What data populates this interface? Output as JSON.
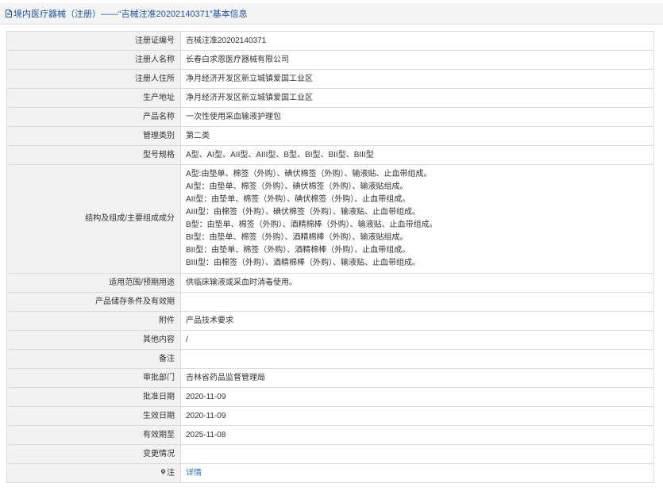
{
  "header": {
    "title": "境内医疗器械（注册）——“吉械注准20202140371”基本信息",
    "icon": "document-icon"
  },
  "rows": {
    "reg_no": {
      "label": "注册证编号",
      "value": "吉械注准20202140371"
    },
    "registrant": {
      "label": "注册人名称",
      "value": "长春白求恩医疗器械有限公司"
    },
    "registrant_address": {
      "label": "注册人住所",
      "value": "净月经济开发区新立城镇爱国工业区"
    },
    "production_address": {
      "label": "生产地址",
      "value": "净月经济开发区新立城镇爱国工业区"
    },
    "product_name": {
      "label": "产品名称",
      "value": "一次性使用采血输液护理包"
    },
    "category": {
      "label": "管理类别",
      "value": "第二类"
    },
    "models": {
      "label": "型号规格",
      "value": "A型、AI型、AII型、AIII型、B型、BI型、BII型、BIII型"
    },
    "composition": {
      "label": "结构及组成/主要组成成分",
      "lines": [
        "A型:由垫单、棉签（外购）、碘伏棉签（外购）、输液贴、止血带组成。",
        "AI型：由垫单、棉签（外购）、碘伏棉签（外购）、输液贴组成。",
        "AII型：由垫单、棉签（外购）、碘伏棉签（外购）、止血带组成。",
        "AIII型：由棉签（外购）、碘伏棉签（外购）、输液贴、止血带组成。",
        "B型：由垫单、棉签（外购）、酒精棉棒（外购）、输液贴、止血带组成。",
        "BI型：由垫单、棉签（外购）、酒精棉棒（外购）、输液贴组成。",
        "BII型：由垫单、棉签（外购）、酒精棉棒（外购）、止血带组成。",
        "BIII型：由棉签（外购）、酒精棉棒（外购）、输液贴、止血带组成。"
      ]
    },
    "intended_use": {
      "label": "适用范围/预期用途",
      "value": "供临床输液或采血时消毒使用。"
    },
    "storage": {
      "label": "产品储存条件及有效期",
      "value": ""
    },
    "attachment": {
      "label": "附件",
      "value": "产品技术要求"
    },
    "other": {
      "label": "其他内容",
      "value": "/"
    },
    "remark": {
      "label": "备注",
      "value": ""
    },
    "approval_dept": {
      "label": "审批部门",
      "value": "吉林省药品监督管理局"
    },
    "approval_date": {
      "label": "批准日期",
      "value": "2020-11-09"
    },
    "effective_date": {
      "label": "生效日期",
      "value": "2020-11-09"
    },
    "valid_until": {
      "label": "有效期至",
      "value": "2025-11-08"
    },
    "changes": {
      "label": "变更情况",
      "value": ""
    },
    "note": {
      "label": "注",
      "icon": "note-icon",
      "link_text": "详情"
    }
  },
  "colors": {
    "header_text": "#1a56a6",
    "link": "#2a6fc9",
    "label_bg": "#f2f2f2",
    "border": "#dcdcdc"
  }
}
